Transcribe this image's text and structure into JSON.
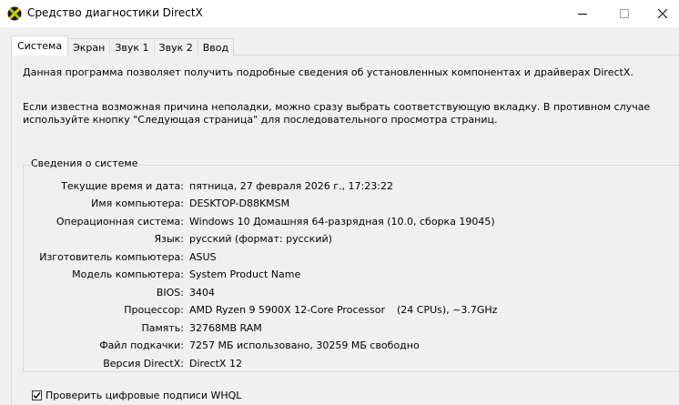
{
  "window": {
    "title": "Средство диагностики DirectX",
    "accent": "#f0f0f0"
  },
  "tabs": [
    {
      "label": "Система",
      "active": true
    },
    {
      "label": "Экран",
      "active": false
    },
    {
      "label": "Звук 1",
      "active": false
    },
    {
      "label": "Звук 2",
      "active": false
    },
    {
      "label": "Ввод",
      "active": false
    }
  ],
  "intro": {
    "line1": "Данная программа позволяет получить подробные сведения об установленных компонентах и драйверах DirectX.",
    "line2": "Если известна возможная причина неполадки, можно сразу выбрать соответствующую вкладку. В противном случае используйте кнопку \"Следующая страница\" для последовательного просмотра страниц."
  },
  "system_info": {
    "title": "Сведения о системе",
    "rows": [
      {
        "label": "Текущие время и дата:",
        "value": "пятница, 27 февраля 2026 г., 17:23:22"
      },
      {
        "label": "Имя компьютера:",
        "value": "DESKTOP-D88KMSM"
      },
      {
        "label": "Операционная система:",
        "value": "Windows 10 Домашняя 64-разрядная (10.0, сборка 19045)"
      },
      {
        "label": "Язык:",
        "value": "русский (формат: русский)"
      },
      {
        "label": "Изготовитель компьютера:",
        "value": "ASUS"
      },
      {
        "label": "Модель компьютера:",
        "value": "System Product Name"
      },
      {
        "label": "BIOS:",
        "value": "3404"
      },
      {
        "label": "Процессор:",
        "value": "AMD Ryzen 9 5900X 12-Core Processor",
        "extra": "(24 CPUs), ~3.7GHz"
      },
      {
        "label": "Память:",
        "value": "32768MB RAM"
      },
      {
        "label": "Файл подкачки:",
        "value": "7257 МБ использовано, 30259 МБ свободно"
      },
      {
        "label": "Версия DirectX:",
        "value": "DirectX 12"
      }
    ]
  },
  "whql": {
    "label": "Проверить цифровые подписи WHQL",
    "checked": true
  }
}
